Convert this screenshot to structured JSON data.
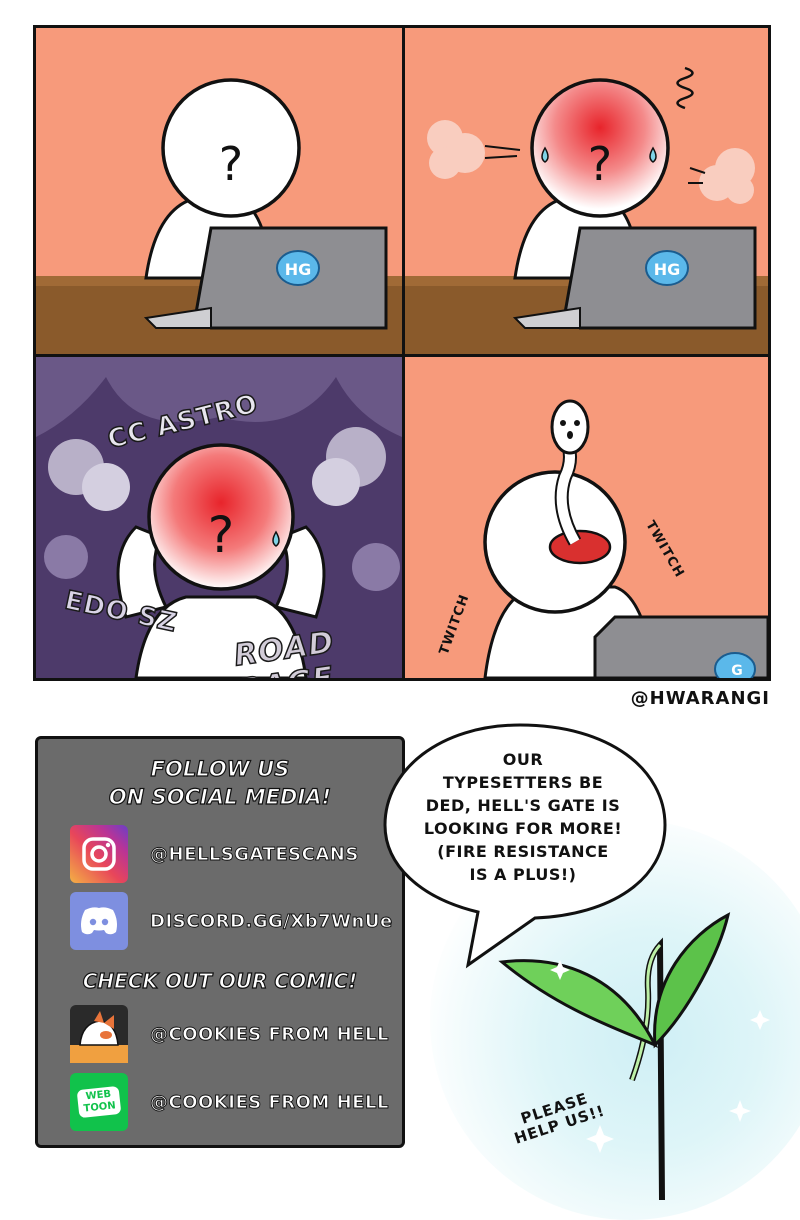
{
  "comic": {
    "panel1": {
      "laptop_logo": "HG",
      "head_mark": "?"
    },
    "panel2": {
      "laptop_logo": "HG",
      "head_mark": "?"
    },
    "panel3": {
      "head_mark": "?",
      "sfx": [
        "CC ASTRO",
        "EDO SZ",
        "ROAD RAGE"
      ]
    },
    "panel4": {
      "laptop_logo": "G",
      "sfx": [
        "TWITCH",
        "TWITCH"
      ]
    },
    "credit": "@HWARANGI"
  },
  "social": {
    "follow_title_line1": "FOLLOW US",
    "follow_title_line2": "ON SOCIAL MEDIA!",
    "instagram": {
      "icon": "instagram-icon",
      "handle": "@HELLSGATESCANS"
    },
    "discord": {
      "icon": "discord-icon",
      "handle": "DISCORD.GG/Xb7WnUe"
    },
    "comic_title": "CHECK OUT OUR COMIC!",
    "comic_app": {
      "icon": "cookies-comic-icon",
      "handle": "@COOKIES FROM HELL"
    },
    "webtoon": {
      "icon": "webtoon-icon",
      "icon_text_line1": "WEB",
      "icon_text_line2": "TOON",
      "handle": "@COOKIES FROM HELL"
    }
  },
  "bubble": {
    "lines": [
      "OUR",
      "TYPESETTERS BE",
      "DED, HELL'S GATE IS",
      "LOOKING FOR MORE!",
      "(FIRE RESISTANCE",
      "IS A PLUS!)"
    ]
  },
  "sprout": {
    "line1": "PLEASE",
    "line2": "HELP US!!"
  },
  "colors": {
    "panel_bg": "#f79a7b",
    "smoke_bg": "#4d3a6a",
    "social_box": "#6b6b6b",
    "laptop": "#8e8e92",
    "desk": "#8a5a2b",
    "blush": "#e8242b",
    "leaf": "#6fd05a"
  }
}
